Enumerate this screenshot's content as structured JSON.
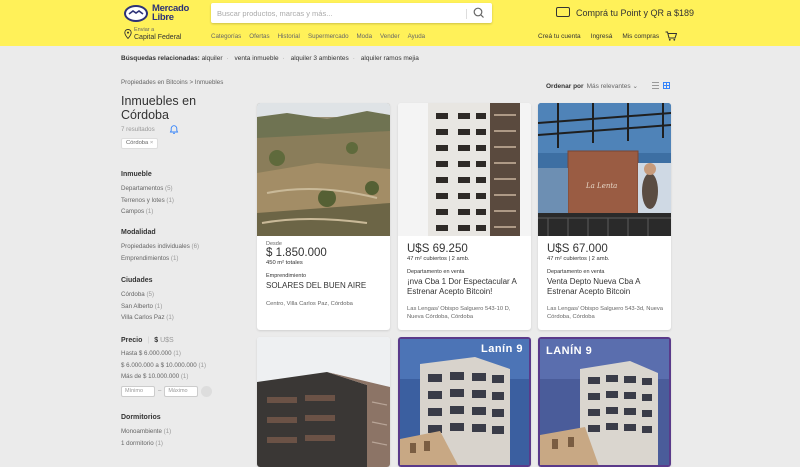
{
  "header": {
    "logo_text": [
      "Mercado",
      "Libre"
    ],
    "search_placeholder": "Buscar productos, marcas y más...",
    "promo_text": "Comprá tu Point y QR a $189",
    "location_small": "Enviar a",
    "location_big": "Capital Federal",
    "nav": [
      "Categorías",
      "Ofertas",
      "Historial",
      "Supermercado",
      "Moda",
      "Vender",
      "Ayuda"
    ],
    "account": [
      "Creá tu cuenta",
      "Ingresá",
      "Mis compras"
    ]
  },
  "related": {
    "label": "Búsquedas relacionadas:",
    "items": [
      "alquiler",
      "venta inmueble",
      "alquiler 3 ambientes",
      "alquiler ramos mejia"
    ]
  },
  "breadcrumb": "Propiedades en Bitcoins  >  Inmuebles",
  "title": "Inmuebles en Córdoba",
  "results": "7 resultados",
  "chip": "Córdoba",
  "filters": {
    "inmueble": {
      "title": "Inmueble",
      "items": [
        {
          "label": "Departamentos",
          "count": "(5)"
        },
        {
          "label": "Terrenos y lotes",
          "count": "(1)"
        },
        {
          "label": "Campos",
          "count": "(1)"
        }
      ]
    },
    "modalidad": {
      "title": "Modalidad",
      "items": [
        {
          "label": "Propiedades individuales",
          "count": "(6)"
        },
        {
          "label": "Emprendimientos",
          "count": "(1)"
        }
      ]
    },
    "ciudades": {
      "title": "Ciudades",
      "items": [
        {
          "label": "Córdoba",
          "count": "(5)"
        },
        {
          "label": "San Alberto",
          "count": "(1)"
        },
        {
          "label": "Villa Carlos Paz",
          "count": "(1)"
        }
      ]
    },
    "precio": {
      "title": "Precio",
      "cur1": "$",
      "cur2": "U$S",
      "items": [
        {
          "label": "Hasta $ 6.000.000",
          "count": "(1)"
        },
        {
          "label": "$ 6.000.000 a $ 10.000.000",
          "count": "(1)"
        },
        {
          "label": "Más de $ 10.000.000",
          "count": "(1)"
        }
      ],
      "min": "Mínimo",
      "max": "Máximo"
    },
    "dormitorios": {
      "title": "Dormitorios",
      "items": [
        {
          "label": "Monoambiente",
          "count": "(1)"
        },
        {
          "label": "1 dormitorio",
          "count": "(1)"
        }
      ]
    }
  },
  "sort": {
    "label": "Ordenar por",
    "value": "Más relevantes"
  },
  "cards": [
    {
      "pre": "Desde",
      "price": "$ 1.850.000",
      "attrs": "450 m² totales",
      "type": "Emprendimiento",
      "title": "SOLARES DEL BUEN AIRE",
      "location": "Centro, Villa Carlos Paz, Córdoba"
    },
    {
      "pre": "",
      "price": "U$S 69.250",
      "attrs": "47 m² cubiertos  |  2 amb.",
      "type": "Departamento en venta",
      "title": "¡nva Cba 1 Dor Espectacular A Estrenar Acepto Bitcoin!",
      "location": "Las Lengas/ Obispo Salguero 543-10 D, Nueva Córdoba, Córdoba"
    },
    {
      "pre": "",
      "price": "U$S 67.000",
      "attrs": "47 m² cubiertos  |  2 amb.",
      "type": "Departamento en venta",
      "title": "Venta Depto Nueva Cba A Estrenar Acepto Bitcoin",
      "location": "Las Lengas/ Obispo Salguero 543-3d, Nueva Córdoba, Córdoba"
    }
  ],
  "overlays": [
    "Lanín 9",
    "LANÍN 9"
  ],
  "colors": {
    "header": "#fff159",
    "brand": "#2d3277",
    "link": "#3483fa"
  }
}
